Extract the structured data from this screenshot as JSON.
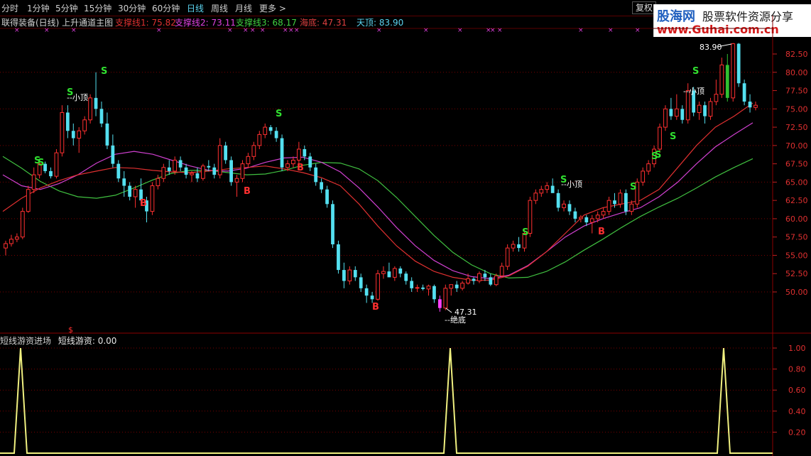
{
  "timeframes": [
    {
      "label": "分时",
      "active": false
    },
    {
      "label": "1分钟",
      "active": false
    },
    {
      "label": "5分钟",
      "active": false
    },
    {
      "label": "15分钟",
      "active": false
    },
    {
      "label": "30分钟",
      "active": false
    },
    {
      "label": "60分钟",
      "active": false
    },
    {
      "label": "日线",
      "active": true
    },
    {
      "label": "周线",
      "active": false
    },
    {
      "label": "月线",
      "active": false
    },
    {
      "label": "更多 >",
      "active": false
    }
  ],
  "restore_button": "复权",
  "logo": {
    "line1": "股海网",
    "line1b": "股票软件资源分享",
    "line2": "www.Guhai.com.cn"
  },
  "main_header": {
    "title": "联得装备(日线) 上升通道主图",
    "items": [
      {
        "label": "支撑线1: 75.82",
        "color": "#e03030"
      },
      {
        "label": "支撑线2: 73.11",
        "color": "#e040e0"
      },
      {
        "label": "支撑线3: 68.17",
        "color": "#40d040"
      },
      {
        "label": "海底: 47.31",
        "color": "#e04040"
      },
      {
        "label": "天顶: 83.90",
        "color": "#5cd4f0"
      }
    ]
  },
  "price_axis": {
    "ticks": [
      "82.50",
      "80.00",
      "77.50",
      "75.00",
      "72.50",
      "70.00",
      "67.50",
      "65.00",
      "62.50",
      "60.00",
      "57.50",
      "55.00",
      "52.50",
      "50.00"
    ]
  },
  "annotations": {
    "top_label": "83.90",
    "bottom_label": "47.31",
    "bottom_text": "--绝底",
    "small_top": "--小顶",
    "sell": "S",
    "buy": "B",
    "dollar": "$"
  },
  "sub_header": {
    "title": "短线游资进场",
    "item": "短线游资: 0.00"
  },
  "sub_axis": {
    "ticks": [
      "1.00",
      "0.80",
      "0.60",
      "0.40",
      "0.20"
    ]
  },
  "chart_data": {
    "type": "candlestick",
    "ylim": [
      47.0,
      84.5
    ],
    "candles": [
      [
        56.0,
        57.0,
        55.0,
        56.6
      ],
      [
        56.6,
        57.8,
        56.2,
        57.2
      ],
      [
        57.2,
        58.0,
        56.8,
        57.5
      ],
      [
        57.5,
        61.5,
        57.2,
        61.0
      ],
      [
        61.0,
        64.5,
        60.8,
        64.0
      ],
      [
        64.0,
        67.0,
        63.5,
        66.0
      ],
      [
        66.0,
        68.0,
        65.5,
        67.5
      ],
      [
        67.5,
        67.8,
        66.2,
        66.5
      ],
      [
        66.5,
        67.0,
        65.5,
        65.8
      ],
      [
        65.8,
        69.5,
        65.5,
        69.0
      ],
      [
        69.0,
        75.5,
        68.5,
        74.5
      ],
      [
        74.5,
        75.5,
        71.0,
        72.0
      ],
      [
        72.0,
        73.0,
        70.0,
        71.0
      ],
      [
        71.0,
        72.5,
        69.0,
        72.0
      ],
      [
        72.0,
        74.0,
        71.5,
        73.5
      ],
      [
        73.5,
        77.0,
        73.0,
        76.5
      ],
      [
        76.5,
        80.0,
        74.0,
        75.0
      ],
      [
        75.0,
        76.0,
        72.5,
        73.0
      ],
      [
        73.0,
        74.5,
        69.5,
        70.0
      ],
      [
        70.0,
        71.5,
        67.0,
        67.5
      ],
      [
        67.5,
        68.0,
        65.0,
        65.5
      ],
      [
        65.5,
        66.5,
        63.0,
        64.5
      ],
      [
        64.5,
        65.0,
        62.5,
        63.0
      ],
      [
        63.0,
        64.5,
        61.5,
        64.0
      ],
      [
        64.0,
        65.5,
        62.0,
        62.5
      ],
      [
        62.5,
        63.0,
        59.5,
        61.0
      ],
      [
        61.0,
        65.0,
        60.5,
        64.5
      ],
      [
        64.5,
        66.0,
        64.0,
        65.5
      ],
      [
        65.5,
        67.5,
        65.0,
        67.0
      ],
      [
        67.0,
        68.0,
        66.0,
        66.5
      ],
      [
        66.5,
        68.5,
        66.0,
        68.0
      ],
      [
        68.0,
        68.5,
        66.5,
        67.0
      ],
      [
        67.0,
        67.5,
        65.5,
        66.0
      ],
      [
        66.0,
        66.5,
        65.0,
        66.2
      ],
      [
        66.2,
        67.0,
        65.0,
        65.5
      ],
      [
        65.5,
        67.5,
        65.2,
        67.2
      ],
      [
        67.2,
        68.0,
        66.5,
        67.0
      ],
      [
        67.0,
        67.5,
        65.5,
        66.0
      ],
      [
        66.0,
        71.0,
        65.5,
        70.0
      ],
      [
        70.0,
        70.5,
        67.5,
        68.0
      ],
      [
        68.0,
        68.5,
        64.5,
        65.0
      ],
      [
        65.0,
        66.0,
        63.0,
        65.5
      ],
      [
        65.5,
        68.0,
        65.0,
        67.5
      ],
      [
        67.5,
        69.0,
        67.0,
        68.5
      ],
      [
        68.5,
        70.5,
        68.0,
        70.0
      ],
      [
        70.0,
        72.0,
        69.5,
        71.5
      ],
      [
        71.5,
        73.0,
        71.0,
        72.5
      ],
      [
        72.5,
        72.8,
        71.5,
        72.0
      ],
      [
        72.0,
        72.5,
        70.5,
        71.0
      ],
      [
        71.0,
        71.5,
        66.5,
        67.0
      ],
      [
        67.0,
        68.0,
        66.5,
        67.5
      ],
      [
        67.5,
        68.5,
        67.0,
        68.0
      ],
      [
        68.0,
        70.5,
        67.5,
        69.5
      ],
      [
        69.5,
        70.0,
        68.0,
        68.5
      ],
      [
        68.5,
        69.0,
        66.5,
        67.0
      ],
      [
        67.0,
        67.5,
        64.5,
        65.0
      ],
      [
        65.0,
        65.5,
        63.5,
        64.0
      ],
      [
        64.0,
        64.5,
        61.5,
        62.0
      ],
      [
        62.0,
        62.5,
        56.0,
        56.5
      ],
      [
        56.5,
        57.0,
        52.5,
        53.0
      ],
      [
        53.0,
        54.0,
        50.5,
        51.5
      ],
      [
        51.5,
        53.5,
        51.0,
        53.0
      ],
      [
        53.0,
        53.5,
        51.5,
        52.0
      ],
      [
        52.0,
        52.5,
        50.0,
        50.5
      ],
      [
        50.5,
        51.0,
        48.5,
        49.5
      ],
      [
        49.5,
        50.0,
        48.5,
        49.0
      ],
      [
        49.0,
        53.0,
        48.8,
        52.5
      ],
      [
        52.5,
        53.5,
        51.8,
        52.8
      ],
      [
        52.8,
        54.0,
        52.0,
        52.0
      ],
      [
        52.0,
        53.5,
        51.5,
        53.2
      ],
      [
        53.2,
        53.5,
        52.0,
        52.5
      ],
      [
        52.5,
        52.8,
        51.0,
        51.5
      ],
      [
        51.5,
        52.0,
        50.0,
        50.5
      ],
      [
        50.5,
        51.0,
        50.0,
        50.6
      ],
      [
        50.6,
        51.0,
        50.2,
        50.4
      ],
      [
        50.4,
        51.0,
        49.5,
        50.8
      ],
      [
        50.8,
        51.0,
        48.5,
        49.0
      ],
      [
        49.0,
        49.5,
        47.3,
        47.8
      ],
      [
        47.8,
        51.0,
        47.5,
        50.5
      ],
      [
        50.5,
        51.0,
        49.5,
        51.0
      ],
      [
        51.0,
        51.5,
        50.0,
        50.5
      ],
      [
        50.5,
        51.5,
        50.2,
        51.2
      ],
      [
        51.2,
        52.5,
        51.0,
        51.8
      ],
      [
        51.8,
        52.0,
        51.0,
        51.5
      ],
      [
        51.5,
        52.8,
        51.2,
        52.5
      ],
      [
        52.5,
        53.0,
        51.5,
        52.0
      ],
      [
        52.0,
        52.5,
        50.8,
        51.0
      ],
      [
        51.0,
        52.5,
        50.8,
        52.2
      ],
      [
        52.2,
        54.0,
        52.0,
        53.5
      ],
      [
        53.5,
        56.5,
        53.0,
        56.0
      ],
      [
        56.0,
        57.0,
        55.5,
        56.5
      ],
      [
        56.5,
        57.5,
        55.5,
        56.0
      ],
      [
        56.0,
        58.5,
        55.5,
        58.0
      ],
      [
        58.0,
        63.0,
        57.5,
        62.5
      ],
      [
        62.5,
        64.0,
        62.0,
        63.5
      ],
      [
        63.5,
        64.5,
        63.0,
        64.0
      ],
      [
        64.0,
        65.0,
        63.5,
        64.5
      ],
      [
        64.5,
        65.5,
        64.0,
        63.5
      ],
      [
        63.5,
        64.0,
        61.0,
        61.5
      ],
      [
        61.5,
        62.5,
        61.0,
        62.0
      ],
      [
        62.0,
        62.5,
        60.5,
        61.0
      ],
      [
        61.0,
        61.5,
        59.5,
        60.0
      ],
      [
        60.0,
        60.5,
        59.5,
        60.2
      ],
      [
        60.2,
        60.5,
        59.0,
        59.5
      ],
      [
        59.5,
        60.5,
        58.0,
        60.0
      ],
      [
        60.0,
        61.0,
        59.5,
        60.5
      ],
      [
        60.5,
        61.5,
        60.0,
        61.0
      ],
      [
        61.0,
        63.0,
        60.5,
        62.5
      ],
      [
        62.5,
        63.5,
        61.5,
        62.0
      ],
      [
        62.0,
        64.0,
        61.5,
        63.5
      ],
      [
        63.5,
        64.0,
        60.5,
        61.0
      ],
      [
        61.0,
        62.5,
        60.5,
        62.0
      ],
      [
        62.0,
        65.5,
        61.5,
        65.0
      ],
      [
        65.0,
        67.0,
        64.5,
        66.5
      ],
      [
        66.5,
        68.0,
        66.0,
        67.5
      ],
      [
        67.5,
        70.0,
        67.0,
        69.5
      ],
      [
        69.5,
        73.0,
        69.0,
        72.5
      ],
      [
        72.5,
        75.5,
        72.0,
        75.0
      ],
      [
        75.0,
        76.5,
        73.5,
        74.0
      ],
      [
        74.0,
        77.0,
        73.5,
        75.0
      ],
      [
        75.0,
        75.5,
        73.0,
        73.5
      ],
      [
        73.5,
        78.5,
        73.0,
        77.5
      ],
      [
        77.5,
        78.0,
        74.0,
        74.5
      ],
      [
        74.5,
        76.0,
        73.5,
        75.5
      ],
      [
        75.5,
        76.0,
        73.0,
        74.0
      ],
      [
        74.0,
        76.5,
        73.5,
        76.0
      ],
      [
        76.0,
        79.0,
        75.5,
        77.0
      ],
      [
        77.0,
        82.0,
        76.5,
        81.0
      ],
      [
        81.0,
        82.5,
        76.0,
        76.5
      ],
      [
        76.5,
        84.0,
        76.0,
        83.9
      ],
      [
        83.9,
        84.0,
        78.0,
        78.5
      ],
      [
        78.5,
        79.0,
        75.5,
        76.0
      ],
      [
        76.0,
        77.0,
        74.5,
        75.2
      ],
      [
        75.2,
        76.0,
        74.8,
        75.5
      ]
    ],
    "support1": [
      61.0,
      62.8,
      64.2,
      65.2,
      66.0,
      66.5,
      67.0,
      66.9,
      66.6,
      66.4,
      66.3,
      66.5,
      66.8,
      67.0,
      67.2,
      66.8,
      66.3,
      65.6,
      64.5,
      62.0,
      59.0,
      56.3,
      54.2,
      52.8,
      52.0,
      51.6,
      51.6,
      52.2,
      53.5,
      55.5,
      58.0,
      60.5,
      61.5,
      62.0,
      62.5,
      64.0,
      67.0,
      70.0,
      72.5,
      74.0,
      75.8
    ],
    "support2": [
      66.0,
      64.5,
      64.0,
      64.8,
      66.0,
      67.6,
      68.8,
      69.2,
      68.8,
      68.0,
      67.2,
      66.6,
      66.5,
      66.9,
      67.7,
      68.3,
      68.4,
      67.7,
      66.4,
      64.2,
      61.6,
      58.8,
      56.3,
      54.3,
      52.9,
      52.1,
      51.8,
      52.3,
      53.6,
      55.5,
      57.5,
      59.0,
      60.0,
      60.8,
      61.5,
      63.0,
      65.0,
      67.5,
      69.8,
      71.5,
      73.1
    ],
    "support3": [
      68.5,
      66.9,
      65.1,
      63.8,
      63.0,
      62.8,
      63.2,
      64.2,
      65.3,
      66.2,
      66.6,
      66.6,
      66.3,
      66.0,
      66.1,
      66.6,
      67.3,
      67.7,
      67.6,
      66.8,
      65.2,
      62.9,
      60.3,
      57.7,
      55.4,
      53.7,
      52.5,
      51.9,
      52.0,
      52.8,
      54.1,
      55.7,
      57.2,
      58.8,
      60.3,
      61.6,
      62.8,
      64.2,
      65.7,
      67.0,
      68.2
    ],
    "sell_marks": [
      [
        9,
        75
      ],
      [
        14,
        79
      ],
      [
        38,
        74
      ],
      [
        122,
        66
      ],
      [
        130,
        70
      ],
      [
        143,
        67
      ],
      [
        172,
        69
      ],
      [
        175,
        70
      ],
      [
        181,
        72
      ],
      [
        190,
        73
      ],
      [
        193,
        79
      ]
    ],
    "buy_marks": [
      [
        41,
        62
      ],
      [
        52,
        64
      ],
      [
        67,
        63
      ],
      [
        72,
        48
      ],
      [
        140,
        58
      ]
    ],
    "indicator": {
      "peaks_x": [
        29,
        634,
        1019
      ],
      "values": [
        1.0,
        1.0,
        1.0
      ]
    }
  }
}
